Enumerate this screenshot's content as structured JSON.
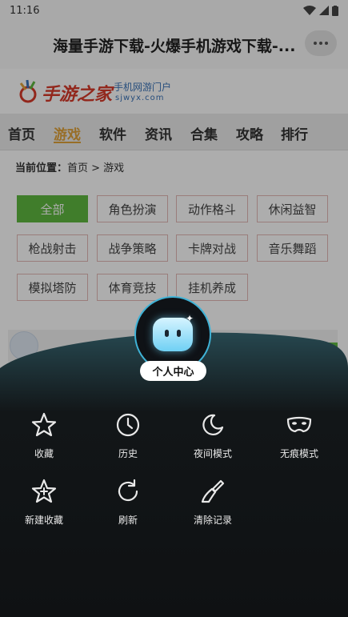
{
  "status_bar": {
    "time": "11:16"
  },
  "header": {
    "title": "海量手游下载-火爆手机游戏下载-..."
  },
  "logo": {
    "name": "手游之家",
    "tagline": "手机网游门户",
    "domain": "sjwyx.com"
  },
  "nav": {
    "items": [
      {
        "label": "首页",
        "active": false
      },
      {
        "label": "游戏",
        "active": true
      },
      {
        "label": "软件",
        "active": false
      },
      {
        "label": "资讯",
        "active": false
      },
      {
        "label": "合集",
        "active": false
      },
      {
        "label": "攻略",
        "active": false
      },
      {
        "label": "排行",
        "active": false
      }
    ]
  },
  "breadcrumb": {
    "prefix": "当前位置：",
    "path": "首页 > 游戏"
  },
  "categories": [
    {
      "label": "全部",
      "active": true
    },
    {
      "label": "角色扮演"
    },
    {
      "label": "动作格斗"
    },
    {
      "label": "休闲益智"
    },
    {
      "label": "枪战射击"
    },
    {
      "label": "战争策略"
    },
    {
      "label": "卡牌对战"
    },
    {
      "label": "音乐舞蹈"
    },
    {
      "label": "模拟塔防"
    },
    {
      "label": "体育竞技"
    },
    {
      "label": "挂机养成"
    }
  ],
  "menu": {
    "personal_center": "个人中心",
    "actions": [
      {
        "label": "收藏",
        "icon": "star-icon"
      },
      {
        "label": "历史",
        "icon": "clock-icon"
      },
      {
        "label": "夜间模式",
        "icon": "moon-icon"
      },
      {
        "label": "无痕模式",
        "icon": "mask-icon"
      },
      {
        "label": "新建收藏",
        "icon": "star-plus-icon"
      },
      {
        "label": "刷新",
        "icon": "refresh-icon"
      },
      {
        "label": "清除记录",
        "icon": "brush-icon"
      }
    ]
  },
  "colors": {
    "accent": "#e0a23a",
    "active_category": "#5fb840",
    "sheet": "#0f1113",
    "ring": "#3fb2d6"
  }
}
